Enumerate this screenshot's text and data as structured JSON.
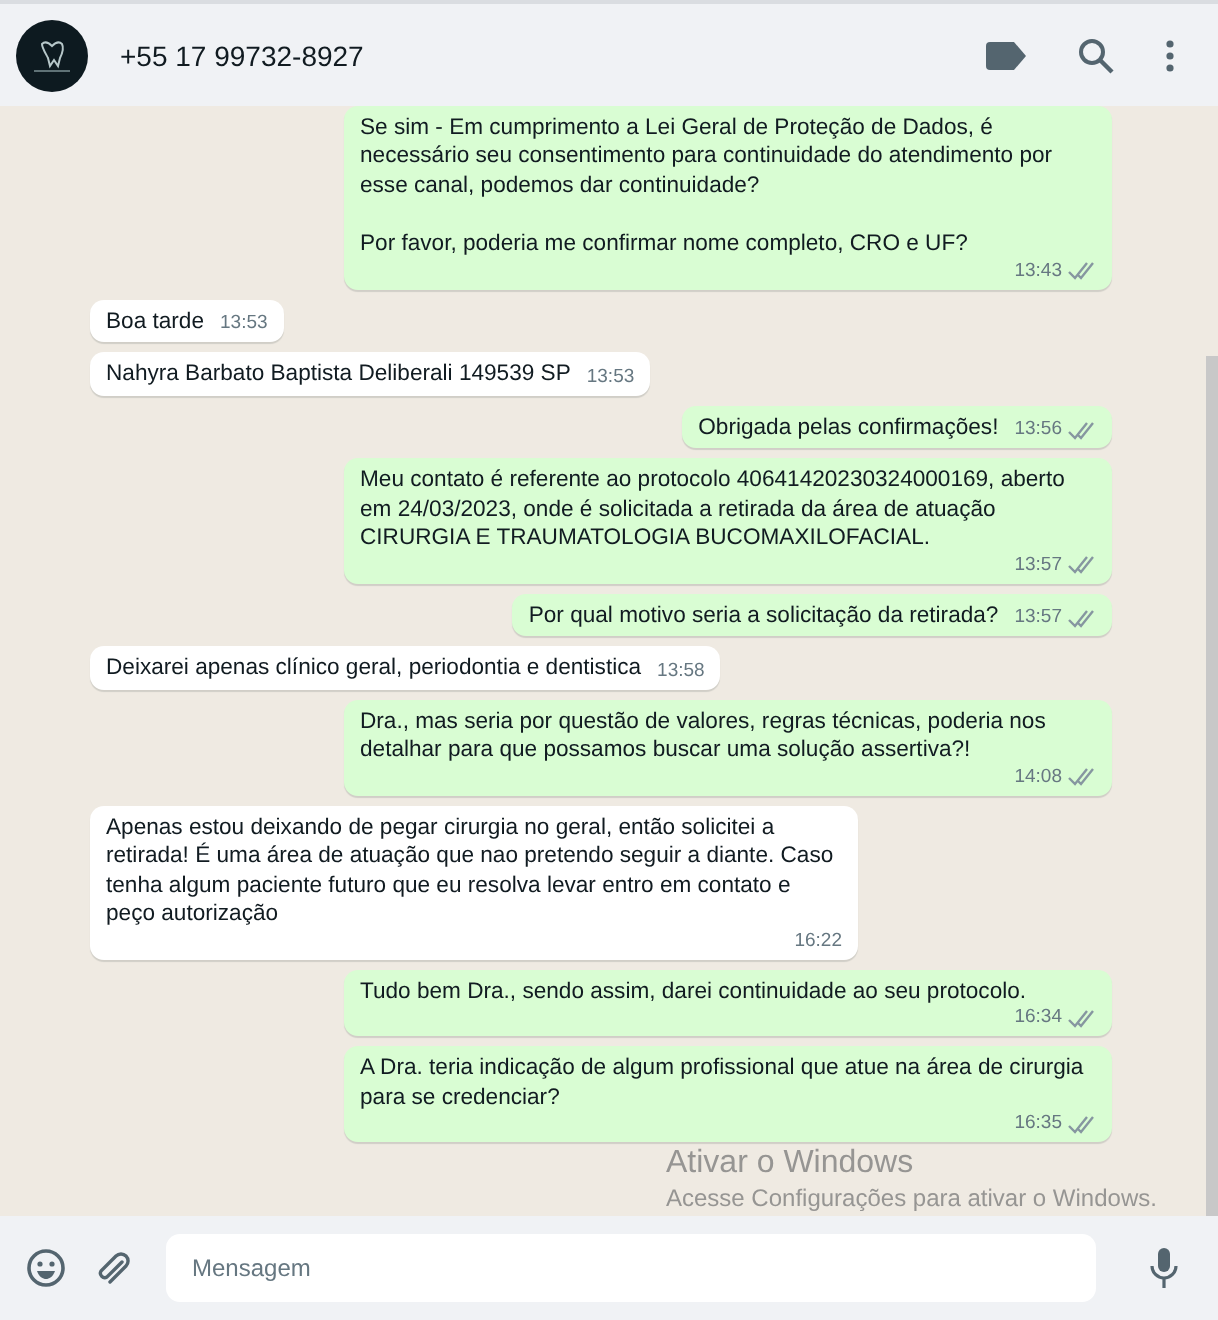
{
  "header": {
    "contact": "+55 17 99732-8927"
  },
  "messages": [
    {
      "outgoing": true,
      "paragraphs": [
        "Se sim - Em cumprimento a Lei Geral de Proteção de Dados, é necessário seu consentimento para continuidade do atendimento por esse canal, podemos dar continuidade?",
        "Por favor, poderia me confirmar nome completo, CRO e UF?"
      ],
      "time": "13:43",
      "read": false
    },
    {
      "outgoing": false,
      "paragraphs": [
        "Boa tarde"
      ],
      "time": "13:53"
    },
    {
      "outgoing": false,
      "paragraphs": [
        "Nahyra Barbato Baptista Deliberali 149539 SP"
      ],
      "time": "13:53"
    },
    {
      "outgoing": true,
      "paragraphs": [
        "Obrigada pelas confirmações!"
      ],
      "time": "13:56",
      "read": false
    },
    {
      "outgoing": true,
      "paragraphs": [
        "Meu contato é referente ao protocolo 40641420230324000169, aberto em 24/03/2023, onde é solicitada a retirada da área de atuação CIRURGIA E TRAUMATOLOGIA BUCOMAXILOFACIAL."
      ],
      "time": "13:57",
      "read": false
    },
    {
      "outgoing": true,
      "paragraphs": [
        "Por qual motivo seria a solicitação da retirada?"
      ],
      "time": "13:57",
      "read": false
    },
    {
      "outgoing": false,
      "paragraphs": [
        "Deixarei apenas clínico geral, periodontia e dentistica"
      ],
      "time": "13:58"
    },
    {
      "outgoing": true,
      "paragraphs": [
        "Dra., mas seria por questão de valores, regras técnicas, poderia nos detalhar para que possamos buscar uma solução assertiva?!"
      ],
      "time": "14:08",
      "read": false
    },
    {
      "outgoing": false,
      "paragraphs": [
        "Apenas estou deixando de pegar cirurgia no geral, então solicitei a retirada! É uma área de atuação que nao pretendo seguir a diante. Caso tenha algum paciente futuro que eu resolva levar entro em contato e peço autorização"
      ],
      "time": "16:22"
    },
    {
      "outgoing": true,
      "paragraphs": [
        "Tudo bem Dra., sendo assim, darei continuidade ao seu protocolo."
      ],
      "time": "16:34",
      "read": false
    },
    {
      "outgoing": true,
      "paragraphs": [
        "A Dra. teria indicação de algum profissional que atue na área de cirurgia para se credenciar?"
      ],
      "time": "16:35",
      "read": false
    }
  ],
  "composer": {
    "placeholder": "Mensagem"
  },
  "activation_notice": {
    "title": "Ativar o Windows",
    "text": "Acesse Configurações para ativar o Windows."
  }
}
